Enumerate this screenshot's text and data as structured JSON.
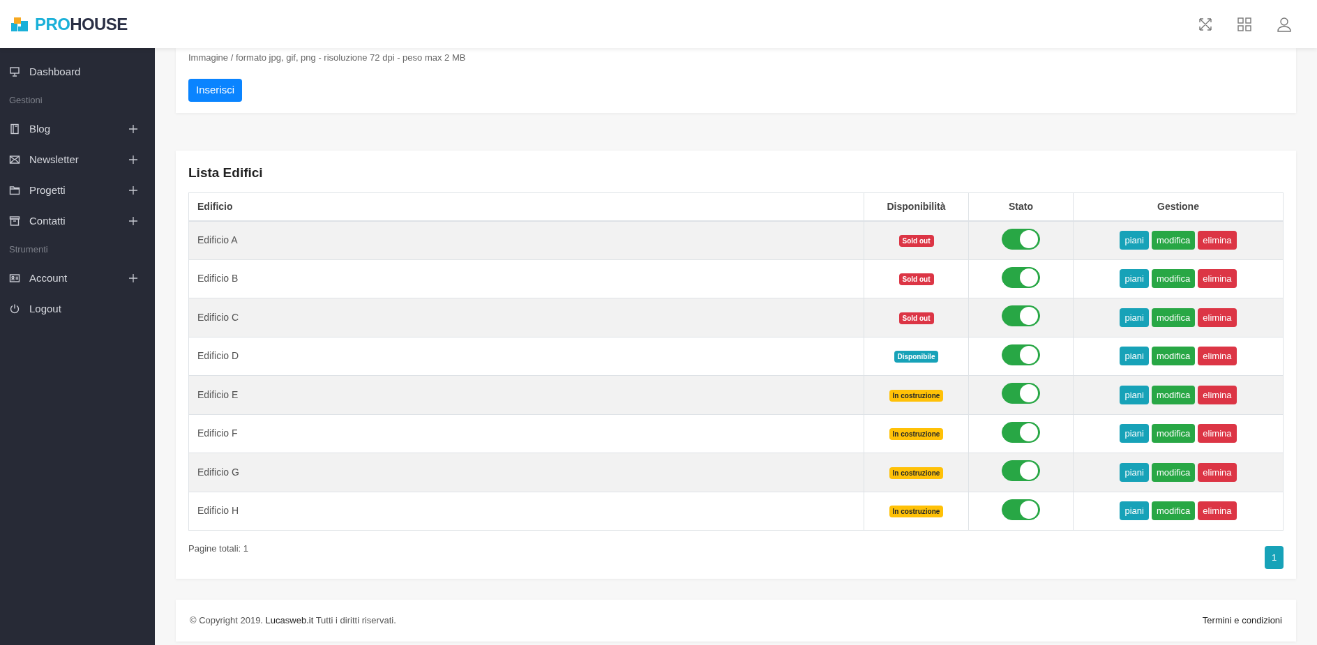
{
  "brand": {
    "prefix": "PRO",
    "suffix": "HOUSE"
  },
  "sidebar": {
    "items": [
      {
        "kind": "link",
        "label": "Dashboard",
        "expandable": false
      },
      {
        "kind": "section",
        "label": "Gestioni"
      },
      {
        "kind": "link",
        "label": "Blog",
        "expandable": true
      },
      {
        "kind": "link",
        "label": "Newsletter",
        "expandable": true
      },
      {
        "kind": "link",
        "label": "Progetti",
        "expandable": true
      },
      {
        "kind": "link",
        "label": "Contatti",
        "expandable": true
      },
      {
        "kind": "section",
        "label": "Strumenti"
      },
      {
        "kind": "link",
        "label": "Account",
        "expandable": true
      },
      {
        "kind": "link",
        "label": "Logout",
        "expandable": false
      }
    ]
  },
  "upload_card": {
    "hint": "Immagine / formato jpg, gif, png - risoluzione 72 dpi - peso max 2 MB",
    "button": "Inserisci"
  },
  "table_card": {
    "title": "Lista Edifici",
    "columns": [
      "Edificio",
      "Disponibilità",
      "Stato",
      "Gestione"
    ],
    "rows": [
      {
        "name": "Edificio A",
        "availability": {
          "label": "Sold out",
          "kind": "danger"
        },
        "on": true,
        "actions": [
          {
            "label": "piani",
            "kind": "info"
          },
          {
            "label": "modifica",
            "kind": "success"
          },
          {
            "label": "elimina",
            "kind": "danger"
          }
        ]
      },
      {
        "name": "Edificio B",
        "availability": {
          "label": "Sold out",
          "kind": "danger"
        },
        "on": true,
        "actions": [
          {
            "label": "piani",
            "kind": "info"
          },
          {
            "label": "modifica",
            "kind": "success"
          },
          {
            "label": "elimina",
            "kind": "danger"
          }
        ]
      },
      {
        "name": "Edificio C",
        "availability": {
          "label": "Sold out",
          "kind": "danger"
        },
        "on": true,
        "actions": [
          {
            "label": "piani",
            "kind": "info"
          },
          {
            "label": "modifica",
            "kind": "success"
          },
          {
            "label": "elimina",
            "kind": "danger"
          }
        ]
      },
      {
        "name": "Edificio D",
        "availability": {
          "label": "Disponibile",
          "kind": "info"
        },
        "on": true,
        "actions": [
          {
            "label": "piani",
            "kind": "info"
          },
          {
            "label": "modifica",
            "kind": "success"
          },
          {
            "label": "elimina",
            "kind": "danger"
          }
        ]
      },
      {
        "name": "Edificio E",
        "availability": {
          "label": "In costruzione",
          "kind": "warning"
        },
        "on": true,
        "actions": [
          {
            "label": "piani",
            "kind": "info"
          },
          {
            "label": "modifica",
            "kind": "success"
          },
          {
            "label": "elimina",
            "kind": "danger"
          }
        ]
      },
      {
        "name": "Edificio F",
        "availability": {
          "label": "In costruzione",
          "kind": "warning"
        },
        "on": true,
        "actions": [
          {
            "label": "piani",
            "kind": "info"
          },
          {
            "label": "modifica",
            "kind": "success"
          },
          {
            "label": "elimina",
            "kind": "danger"
          }
        ]
      },
      {
        "name": "Edificio G",
        "availability": {
          "label": "In costruzione",
          "kind": "warning"
        },
        "on": true,
        "actions": [
          {
            "label": "piani",
            "kind": "info"
          },
          {
            "label": "modifica",
            "kind": "success"
          },
          {
            "label": "elimina",
            "kind": "danger"
          }
        ]
      },
      {
        "name": "Edificio H",
        "availability": {
          "label": "In costruzione",
          "kind": "warning"
        },
        "on": true,
        "actions": [
          {
            "label": "piani",
            "kind": "info"
          },
          {
            "label": "modifica",
            "kind": "success"
          },
          {
            "label": "elimina",
            "kind": "danger"
          }
        ]
      }
    ],
    "total_pages": "Pagine totali: 1",
    "pages": [
      {
        "label": "1",
        "selected": true
      }
    ]
  },
  "footer": {
    "prefix": "© Copyright 2019.",
    "link": "Lucasweb.it",
    "suffix": "Tutti i diritti riservati.",
    "terms": "Termini e condizioni"
  }
}
